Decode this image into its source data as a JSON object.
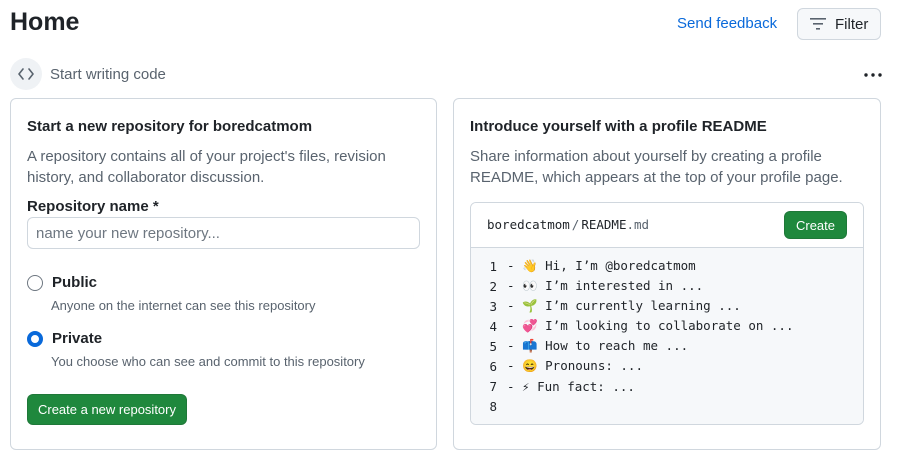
{
  "header": {
    "title": "Home",
    "feedback_label": "Send feedback",
    "filter_label": "Filter"
  },
  "section": {
    "title": "Start writing code",
    "icon": "code-icon"
  },
  "new_repo_card": {
    "title": "Start a new repository for boredcatmom",
    "description": "A repository contains all of your project's files, revision history, and collaborator discussion.",
    "field_label": "Repository name *",
    "input_value": "",
    "input_placeholder": "name your new repository...",
    "visibility": {
      "selected": "private",
      "public_label": "Public",
      "public_desc": "Anyone on the internet can see this repository",
      "private_label": "Private",
      "private_desc": "You choose who can see and commit to this repository"
    },
    "create_label": "Create a new repository"
  },
  "readme_card": {
    "title": "Introduce yourself with a profile README",
    "description": "Share information about yourself by creating a profile README, which appears at the top of your profile page.",
    "path_user": "boredcatmom",
    "path_sep": "/",
    "path_file": "README",
    "path_ext": ".md",
    "create_label": "Create",
    "lines": [
      {
        "num": "1",
        "text": "- 👋 Hi, I’m @boredcatmom"
      },
      {
        "num": "2",
        "text": "- 👀 I’m interested in ..."
      },
      {
        "num": "3",
        "text": "- 🌱 I’m currently learning ..."
      },
      {
        "num": "4",
        "text": "- 💞️ I’m looking to collaborate on ..."
      },
      {
        "num": "5",
        "text": "- 📫 How to reach me ..."
      },
      {
        "num": "6",
        "text": "- 😄 Pronouns: ..."
      },
      {
        "num": "7",
        "text": "- ⚡ Fun fact: ..."
      },
      {
        "num": "8",
        "text": ""
      }
    ]
  },
  "colors": {
    "accent_blue": "#0969da",
    "primary_green": "#1f883d",
    "border": "#d0d7de",
    "muted_text": "#59636e"
  }
}
